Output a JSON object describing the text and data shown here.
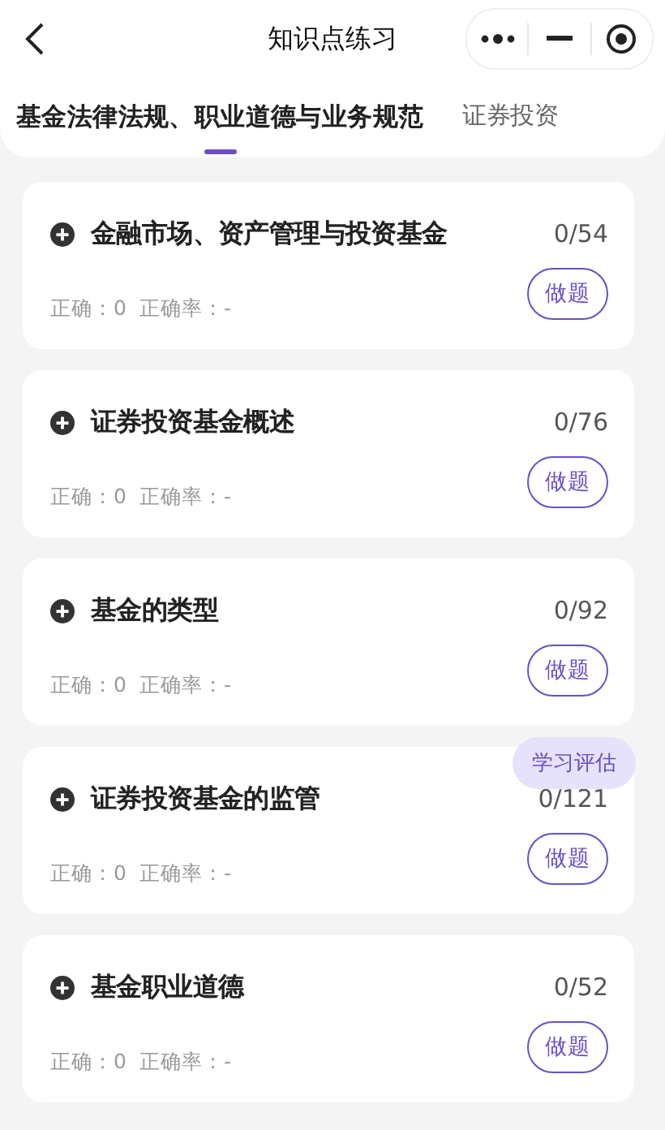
{
  "window": {
    "title": "知识点练习"
  },
  "tabs": [
    {
      "label": "基金法律法规、职业道德与业务规范",
      "selected": true
    },
    {
      "label": "证券投资",
      "selected": false
    }
  ],
  "chapters": [
    {
      "title": "金融市场、资产管理与投资基金",
      "count": "0/54",
      "correct": "正确：0",
      "rate": "正确率：-",
      "action": "做题"
    },
    {
      "title": "证券投资基金概述",
      "count": "0/76",
      "correct": "正确：0",
      "rate": "正确率：-",
      "action": "做题"
    },
    {
      "title": "基金的类型",
      "count": "0/92",
      "correct": "正确：0",
      "rate": "正确率：-",
      "action": "做题"
    },
    {
      "title": "证券投资基金的监管",
      "count": "0/121",
      "correct": "正确：0",
      "rate": "正确率：-",
      "action": "做题"
    },
    {
      "title": "基金职业道德",
      "count": "0/52",
      "correct": "正确：0",
      "rate": "正确率：-",
      "action": "做题"
    }
  ],
  "float_button": "学习评估"
}
